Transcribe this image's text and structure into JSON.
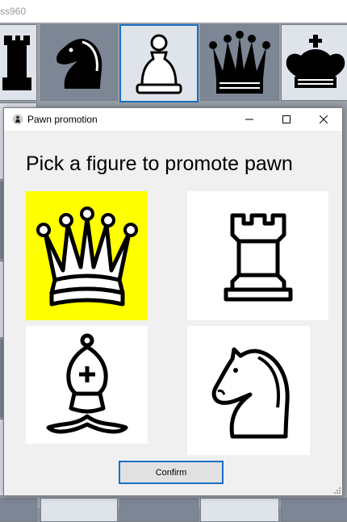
{
  "parent_window": {
    "title_fragment": "ss960"
  },
  "dialog": {
    "title": "Pawn promotion",
    "heading": "Pick a figure to promote pawn",
    "window_buttons": {
      "minimize": "—",
      "maximize": "☐",
      "close": "✕"
    },
    "choices": [
      {
        "piece": "queen",
        "icon": "queen-icon",
        "selected": true
      },
      {
        "piece": "rook",
        "icon": "rook-icon",
        "selected": false
      },
      {
        "piece": "bishop",
        "icon": "bishop-icon",
        "selected": false
      },
      {
        "piece": "knight",
        "icon": "knight-icon",
        "selected": false
      }
    ],
    "confirm_label": "Confirm"
  },
  "colors": {
    "selected_background": "#ffff00",
    "confirm_border": "#1c6fc4",
    "board_dark": "#7d8694",
    "board_light": "#dfe3ea"
  }
}
